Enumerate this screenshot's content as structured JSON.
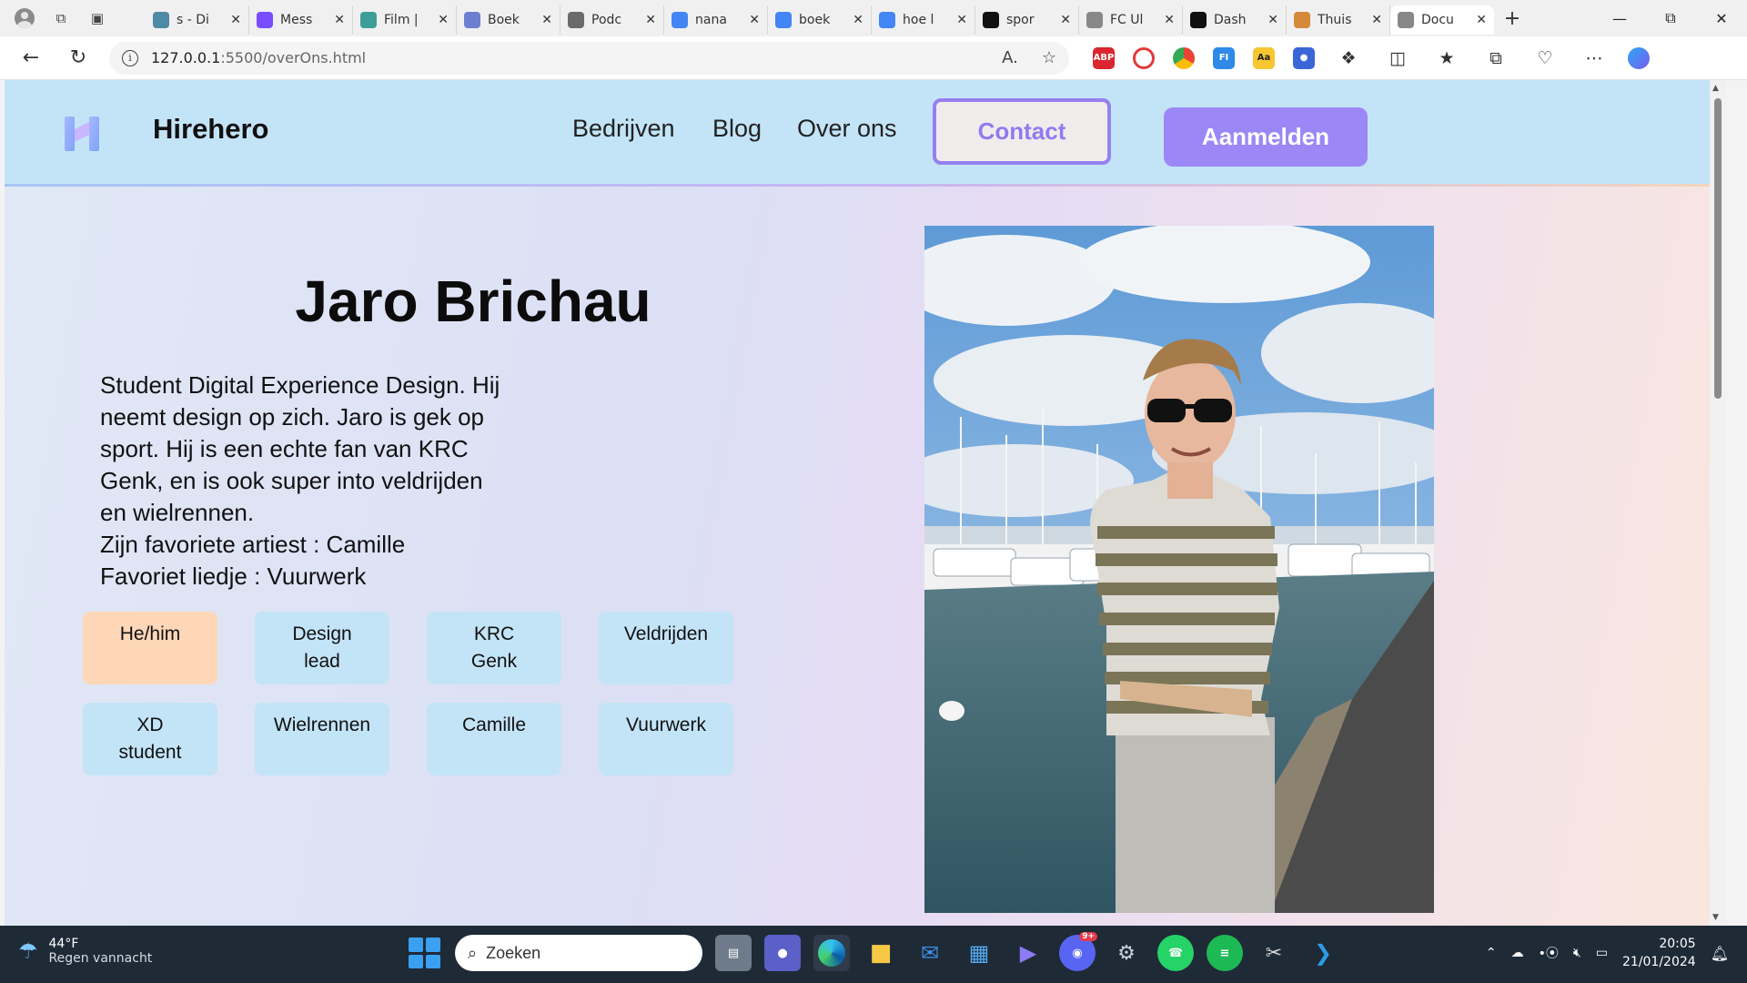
{
  "browser": {
    "tabs": [
      {
        "title": "s - Di",
        "fav_color": "#4e8aa6",
        "fav_icon": "globe-icon"
      },
      {
        "title": "Mess",
        "fav_color": "#7a4cff",
        "fav_icon": "messenger-icon"
      },
      {
        "title": "Film |",
        "fav_color": "#3d9d97",
        "fav_icon": "film-icon"
      },
      {
        "title": "Boek",
        "fav_color": "#6c7fd0",
        "fav_icon": "book-icon"
      },
      {
        "title": "Podc",
        "fav_color": "#6b6b6b",
        "fav_icon": "podcast-icon"
      },
      {
        "title": "nana",
        "fav_color": "#4285f4",
        "fav_icon": "google-icon"
      },
      {
        "title": "boek",
        "fav_color": "#4285f4",
        "fav_icon": "google-icon"
      },
      {
        "title": "hoe l",
        "fav_color": "#4285f4",
        "fav_icon": "google-icon"
      },
      {
        "title": "spor",
        "fav_color": "#111111",
        "fav_icon": "s-icon"
      },
      {
        "title": "FC Ul",
        "fav_color": "#888888",
        "fav_icon": "page-icon"
      },
      {
        "title": "Dash",
        "fav_color": "#111111",
        "fav_icon": "dashboard-icon"
      },
      {
        "title": "Thuis",
        "fav_color": "#d48a3a",
        "fav_icon": "avatar-icon"
      },
      {
        "title": "Docu",
        "fav_color": "#888888",
        "fav_icon": "page-icon"
      }
    ],
    "url_host": "127.0.0.1",
    "url_path": ":5500/overOns.html"
  },
  "site": {
    "brand": "Hirehero",
    "nav": [
      "Bedrijven",
      "Blog",
      "Over ons"
    ],
    "contact_label": "Contact",
    "register_label": "Aanmelden",
    "accent_color": "#9b88f6",
    "header_color": "#c3e4f7"
  },
  "profile": {
    "name": "Jaro Brichau",
    "bio_lines": [
      "Student Digital Experience Design. Hij",
      "neemt design op zich. Jaro is gek op",
      "sport. Hij is een echte fan van KRC",
      "Genk, en is ook super into veldrijden",
      "en wielrennen.",
      "Zijn favoriete artiest : Camille",
      "Favoriet liedje : Vuurwerk"
    ],
    "tags": [
      [
        "He/him"
      ],
      [
        "Design",
        "lead"
      ],
      [
        "KRC",
        "Genk"
      ],
      [
        "Veldrijden"
      ],
      [
        "XD",
        "student"
      ],
      [
        "Wielrennen"
      ],
      [
        "Camille"
      ],
      [
        "Vuurwerk"
      ]
    ],
    "tag_colors": {
      "default": "#c3e4f7",
      "highlight": "#fdd7b7"
    }
  },
  "taskbar": {
    "weather_temp": "44°F",
    "weather_desc": "Regen vannacht",
    "search_placeholder": "Zoeken",
    "time": "20:05",
    "date": "21/01/2024",
    "discord_badge": "9+"
  }
}
